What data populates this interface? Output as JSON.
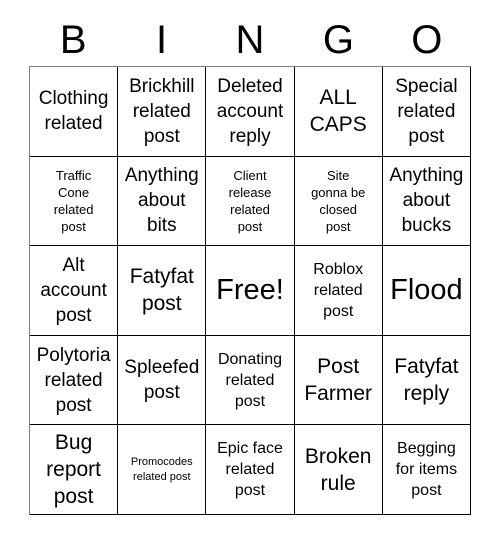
{
  "header": {
    "letters": [
      "B",
      "I",
      "N",
      "G",
      "O"
    ]
  },
  "grid": {
    "rows": 5,
    "columns": 5,
    "cells": [
      {
        "text": "Clothing\nrelated",
        "size": "lg"
      },
      {
        "text": "Brickhill\nrelated\npost",
        "size": "lg"
      },
      {
        "text": "Deleted\naccount\nreply",
        "size": "lg"
      },
      {
        "text": "ALL\nCAPS",
        "size": "xl"
      },
      {
        "text": "Special\nrelated\npost",
        "size": "lg"
      },
      {
        "text": "Traffic\nCone\nrelated\npost",
        "size": "sm"
      },
      {
        "text": "Anything\nabout\nbits",
        "size": "lg"
      },
      {
        "text": "Client\nrelease\nrelated\npost",
        "size": "sm"
      },
      {
        "text": "Site\ngonna be\nclosed\npost",
        "size": "sm"
      },
      {
        "text": "Anything\nabout\nbucks",
        "size": "lg"
      },
      {
        "text": "Alt\naccount\npost",
        "size": "lg"
      },
      {
        "text": "Fatyfat\npost",
        "size": "xl"
      },
      {
        "text": "Free!",
        "size": "xxl"
      },
      {
        "text": "Roblox\nrelated\npost",
        "size": "md"
      },
      {
        "text": "Flood",
        "size": "xxl"
      },
      {
        "text": "Polytoria\nrelated\npost",
        "size": "lg"
      },
      {
        "text": "Spleefed\npost",
        "size": "lg"
      },
      {
        "text": "Donating\nrelated\npost",
        "size": "md"
      },
      {
        "text": "Post\nFarmer",
        "size": "xl"
      },
      {
        "text": "Fatyfat\nreply",
        "size": "xl"
      },
      {
        "text": "Bug\nreport\npost",
        "size": "xl"
      },
      {
        "text": "Promocodes\nrelated post",
        "size": "xs"
      },
      {
        "text": "Epic face\nrelated\npost",
        "size": "md"
      },
      {
        "text": "Broken\nrule",
        "size": "xl"
      },
      {
        "text": "Begging\nfor items\npost",
        "size": "md"
      }
    ]
  }
}
